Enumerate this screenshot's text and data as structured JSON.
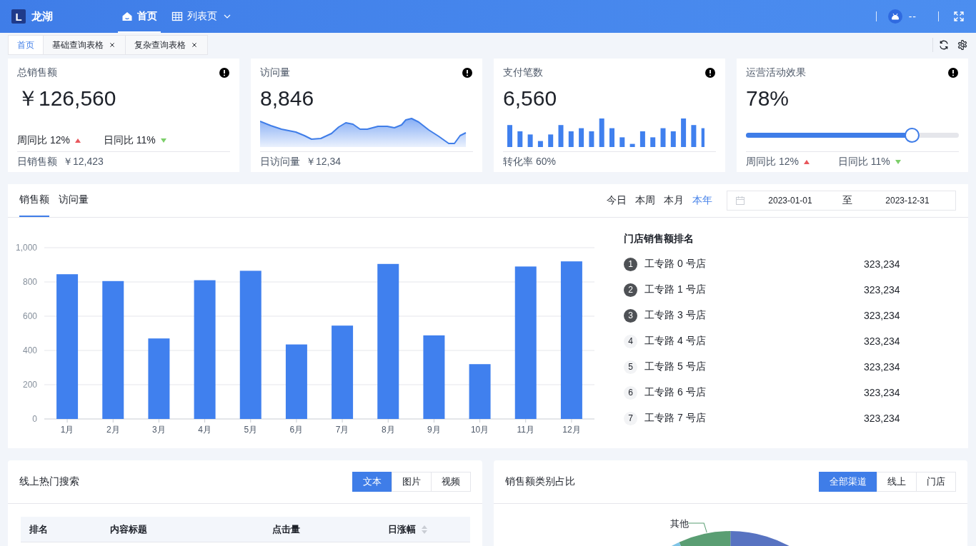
{
  "header": {
    "logo_mark": "L",
    "brand": "龙湖",
    "nav": [
      {
        "label": "首页",
        "selected": true,
        "dropdown": false
      },
      {
        "label": "列表页",
        "selected": false,
        "dropdown": true
      }
    ],
    "user": "--"
  },
  "tabs": [
    {
      "label": "首页",
      "selected": true,
      "closable": false
    },
    {
      "label": "基础查询表格",
      "selected": false,
      "closable": true
    },
    {
      "label": "复杂查询表格",
      "selected": false,
      "closable": true
    }
  ],
  "cards": [
    {
      "kind": "plain",
      "title": "总销售额",
      "value": "￥126,560",
      "trends": [
        {
          "label": "周同比 12%",
          "rising": true
        },
        {
          "label": "日同比 11%",
          "rising": false
        }
      ],
      "footer_label": "日销售额",
      "footer_value": "￥12,423"
    },
    {
      "kind": "sparkline",
      "title": "访问量",
      "value": "8,846",
      "footer_label": "日访问量",
      "footer_value": "￥12,34"
    },
    {
      "kind": "bars",
      "title": "支付笔数",
      "value": "6,560",
      "footer_label": "转化率 60%"
    },
    {
      "kind": "slider",
      "title": "运营活动效果",
      "value": "78%",
      "level": 0.78,
      "footer_trends": [
        {
          "label": "周同比 12%",
          "rising": true
        },
        {
          "label": "日同比 11%",
          "rising": false
        }
      ]
    }
  ],
  "sales": {
    "tabs": [
      {
        "label": "销售额",
        "selected": true
      },
      {
        "label": "访问量",
        "selected": false
      }
    ],
    "ranges": [
      {
        "label": "今日",
        "selected": false
      },
      {
        "label": "本周",
        "selected": false
      },
      {
        "label": "本月",
        "selected": false
      },
      {
        "label": "本年",
        "selected": true
      }
    ],
    "date_start": "2023-01-01",
    "date_sep": "至",
    "date_end": "2023-12-31",
    "chart_data": {
      "type": "bar",
      "categories": [
        "1月",
        "2月",
        "3月",
        "4月",
        "5月",
        "6月",
        "7月",
        "8月",
        "9月",
        "10月",
        "11月",
        "12月"
      ],
      "values": [
        845,
        805,
        470,
        810,
        865,
        435,
        545,
        905,
        488,
        320,
        890,
        920
      ],
      "ylim": [
        0,
        1000
      ],
      "grid": true,
      "yticks": [
        0,
        200,
        400,
        600,
        800,
        {
          "value": 1000,
          "label": "1,000"
        }
      ]
    },
    "ranking_title": "门店销售额排名",
    "ranking": [
      {
        "rank": "1",
        "name": "工专路 0 号店",
        "value": "323,234",
        "top": true
      },
      {
        "rank": "2",
        "name": "工专路 1 号店",
        "value": "323,234",
        "top": true
      },
      {
        "rank": "3",
        "name": "工专路 3 号店",
        "value": "323,234",
        "top": true
      },
      {
        "rank": "4",
        "name": "工专路 4 号店",
        "value": "323,234",
        "top": false
      },
      {
        "rank": "5",
        "name": "工专路 5 号店",
        "value": "323,234",
        "top": false
      },
      {
        "rank": "6",
        "name": "工专路 6 号店",
        "value": "323,234",
        "top": false
      },
      {
        "rank": "7",
        "name": "工专路 7 号店",
        "value": "323,234",
        "top": false
      }
    ]
  },
  "hot_search": {
    "title": "线上热门搜索",
    "options": [
      {
        "label": "文本",
        "selected": true
      },
      {
        "label": "图片",
        "selected": false
      },
      {
        "label": "视频",
        "selected": false
      }
    ],
    "columns": [
      {
        "label": "排名",
        "sortable": false
      },
      {
        "label": "内容标题",
        "sortable": false
      },
      {
        "label": "点击量",
        "sortable": false
      },
      {
        "label": "日涨幅",
        "sortable": true
      }
    ]
  },
  "category_share": {
    "title": "销售额类别占比",
    "options": [
      {
        "label": "全部渠道",
        "selected": true
      },
      {
        "label": "线上",
        "selected": false
      },
      {
        "label": "门店",
        "selected": false
      }
    ],
    "slice_label": "其他"
  }
}
